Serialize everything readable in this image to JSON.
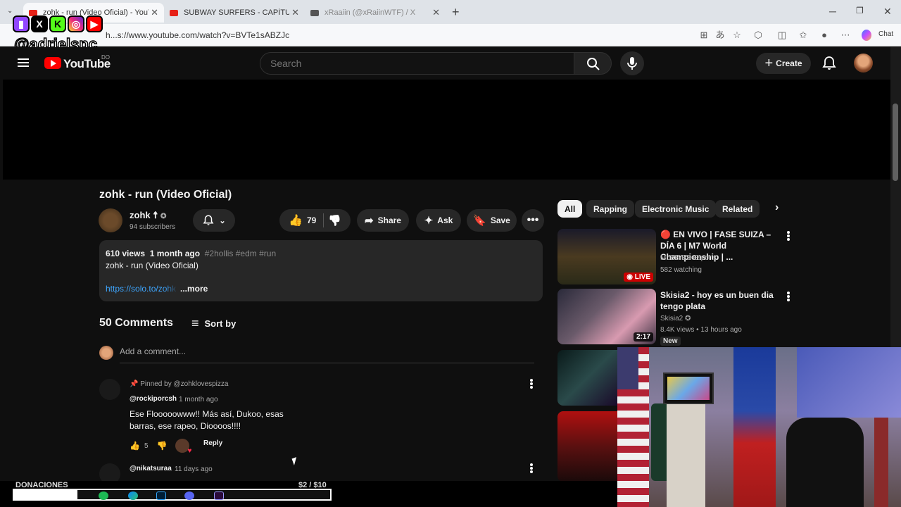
{
  "browser": {
    "tabs": [
      {
        "label": "zohk - run (Video Oficial) - YouTub",
        "active": true
      },
      {
        "label": "SUBWAY SURFERS - CAPÍTULO 1 |",
        "active": false
      },
      {
        "label": "xRaaiin (@xRaiinWTF) / X",
        "active": false
      }
    ],
    "url": "h...s://www.youtube.com/watch?v=BVTe1sABZJc",
    "chat_label": "Chat"
  },
  "overlay": {
    "social_icons": [
      "twitch-icon",
      "x-icon",
      "kick-icon",
      "instagram-icon",
      "youtube-icon"
    ],
    "handle": "@adrielsnc",
    "donations_label": "DONACIONES",
    "donations_amount": "$2 / $10",
    "donations_progress": 0.2
  },
  "youtube": {
    "logo_text": "YouTube",
    "country": "DO",
    "search_placeholder": "Search",
    "create_label": "Create"
  },
  "video": {
    "title": "zohk - run (Video Oficial)",
    "channel": "zohk ☨",
    "subscribers": "94 subscribers",
    "likes": "79",
    "share": "Share",
    "ask": "Ask",
    "save": "Save",
    "views": "610 views",
    "age": "1 month ago",
    "tags": "#2hollis #edm #run",
    "desc_line": "zohk - run (Video Oficial)",
    "desc_link": "https://solo.to/zohk",
    "more": "...more"
  },
  "comments": {
    "count": "50 Comments",
    "sort": "Sort by",
    "add": "Add a comment...",
    "items": [
      {
        "pinned": "Pinned by @zohklovespizza",
        "user": "@rockiporcsh",
        "time": "1 month ago",
        "text": "Ese Flooooowww!! Más así, Dukoo, esas barras, ese rapeo, Dioooos!!!!",
        "likes": "5",
        "reply": "Reply"
      },
      {
        "user": "@nikatsuraa",
        "time": "11 days ago"
      }
    ]
  },
  "recs": {
    "chips": [
      "All",
      "Rapping",
      "Electronic Music",
      "Related"
    ],
    "items": [
      {
        "title": "🔴 EN VIVO | FASE SUIZA – DÍA 6 | M7 World Championship | ...",
        "channel": "MLBB ES Esports",
        "meta": "582 watching",
        "badge": "LIVE"
      },
      {
        "title": "Skisia2 - hoy es un buen dia tengo plata",
        "channel": "Skisia2",
        "meta": "8.4K views • 13 hours ago",
        "duration": "2:17",
        "badge": "New"
      }
    ]
  },
  "colors": {
    "youtube_red": "#ff0000",
    "link_blue": "#3ea6ff",
    "live_red": "#cc0000"
  }
}
